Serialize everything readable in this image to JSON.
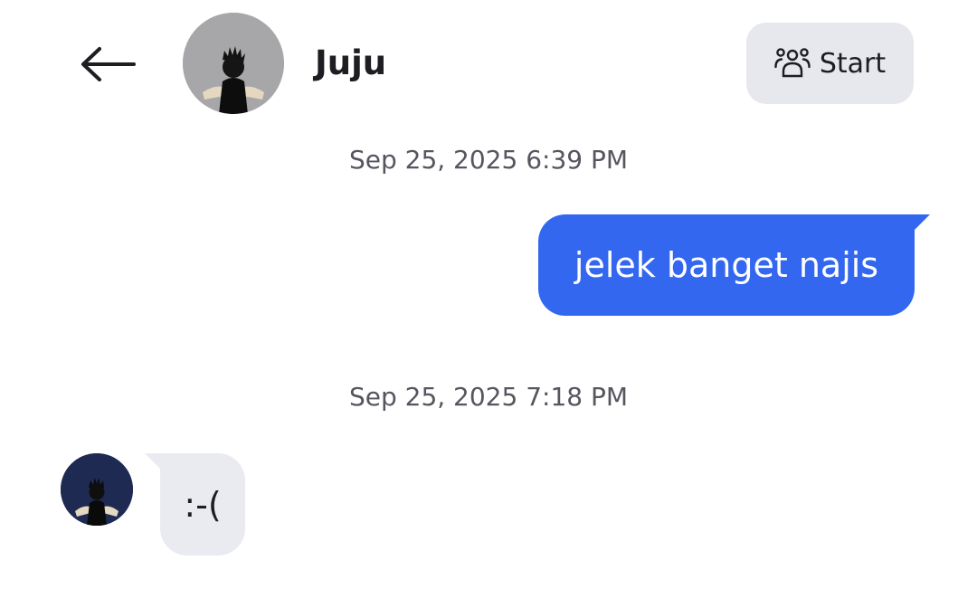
{
  "header": {
    "contact_name": "Juju",
    "start_label": "Start",
    "back_icon": "arrow-left-icon",
    "start_icon": "group-icon"
  },
  "conversation": [
    {
      "timestamp": "Sep 25, 2025 6:39 PM",
      "direction": "outgoing",
      "text": "jelek banget najis"
    },
    {
      "timestamp": "Sep 25, 2025 7:18 PM",
      "direction": "incoming",
      "text": ":-("
    }
  ],
  "colors": {
    "outgoing_bubble": "#3367f0",
    "incoming_bubble": "#e9ebf1",
    "start_button_bg": "#e6e8ee",
    "text_primary": "#1d1d22",
    "timestamp_text": "#55565e"
  }
}
